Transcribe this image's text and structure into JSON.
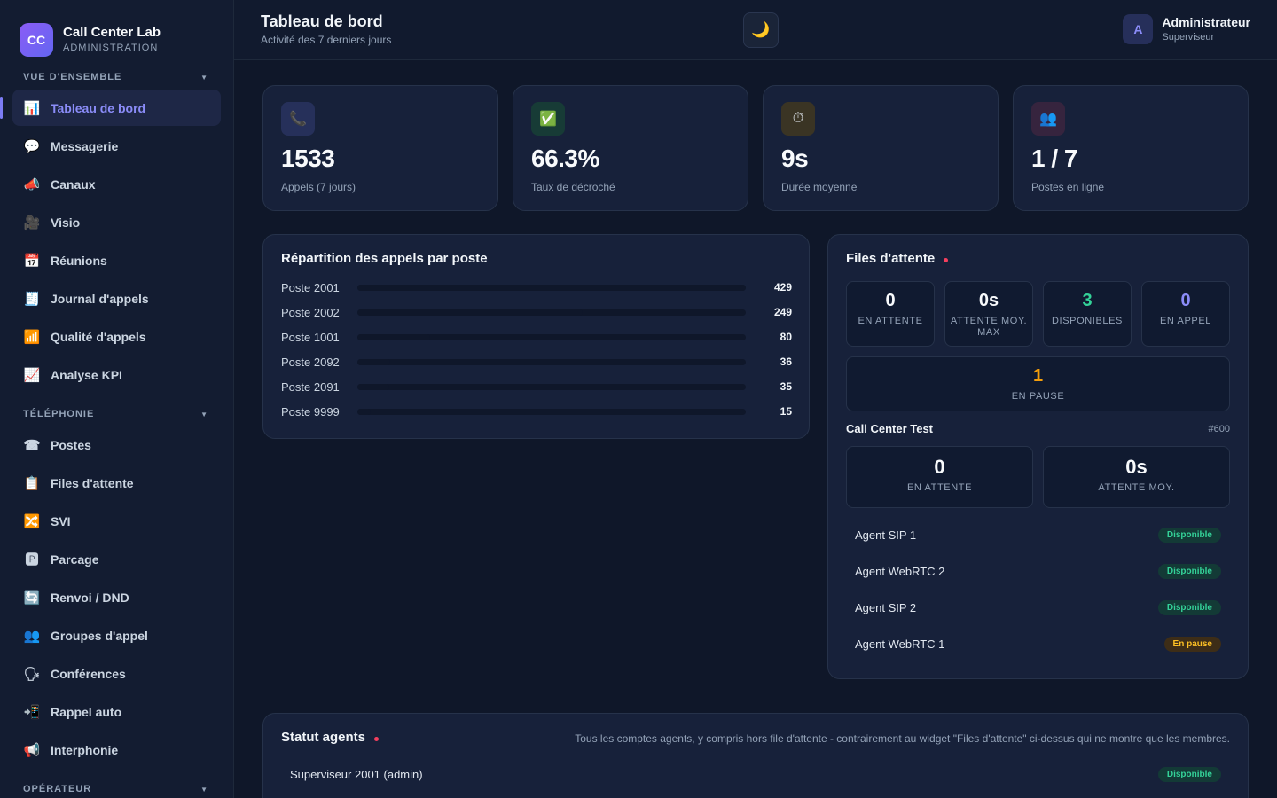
{
  "brand": {
    "logo": "CC",
    "name": "Call Center Lab",
    "subtitle": "ADMINISTRATION"
  },
  "sidebar": {
    "sections": [
      {
        "label": "VUE D'ENSEMBLE",
        "items": [
          {
            "icon": "📊",
            "icon_name": "bar-chart-icon",
            "label": "Tableau de bord",
            "active": true
          },
          {
            "icon": "💬",
            "icon_name": "speech-bubble-icon",
            "label": "Messagerie"
          },
          {
            "icon": "📣",
            "icon_name": "megaphone-icon",
            "label": "Canaux"
          },
          {
            "icon": "🎥",
            "icon_name": "video-camera-icon",
            "label": "Visio"
          },
          {
            "icon": "📅",
            "icon_name": "calendar-icon",
            "label": "Réunions"
          },
          {
            "icon": "🧾",
            "icon_name": "receipt-icon",
            "label": "Journal d'appels"
          },
          {
            "icon": "📶",
            "icon_name": "signal-icon",
            "label": "Qualité d'appels"
          },
          {
            "icon": "📈",
            "icon_name": "trend-chart-icon",
            "label": "Analyse KPI"
          }
        ]
      },
      {
        "label": "TÉLÉPHONIE",
        "items": [
          {
            "icon": "☎",
            "icon_name": "telephone-icon",
            "label": "Postes"
          },
          {
            "icon": "📋",
            "icon_name": "clipboard-icon",
            "label": "Files d'attente"
          },
          {
            "icon": "🔀",
            "icon_name": "shuffle-icon",
            "label": "SVI"
          },
          {
            "icon": "🅿",
            "icon_name": "parking-icon",
            "label": "Parcage"
          },
          {
            "icon": "🔄",
            "icon_name": "forward-icon",
            "label": "Renvoi / DND"
          },
          {
            "icon": "👥",
            "icon_name": "group-icon",
            "label": "Groupes d'appel"
          },
          {
            "icon": "🗣",
            "icon_name": "speaking-head-icon",
            "label": "Conférences"
          },
          {
            "icon": "📲",
            "icon_name": "mobile-callback-icon",
            "label": "Rappel auto"
          },
          {
            "icon": "📢",
            "icon_name": "loudspeaker-icon",
            "label": "Interphonie"
          }
        ]
      },
      {
        "label": "OPÉRATEUR",
        "items": []
      }
    ]
  },
  "header": {
    "title": "Tableau de bord",
    "subtitle": "Activité des 7 derniers jours",
    "theme_icon": "🌙"
  },
  "user": {
    "initial": "A",
    "name": "Administrateur",
    "role": "Superviseur"
  },
  "stats": [
    {
      "icon": "📞",
      "icon_name": "phone-icon",
      "icon_bg": "#26305a",
      "value": "1533",
      "label": "Appels (7 jours)"
    },
    {
      "icon": "✅",
      "icon_name": "check-icon",
      "icon_bg": "#173b36",
      "value": "66.3%",
      "label": "Taux de décroché"
    },
    {
      "icon": "⏱",
      "icon_name": "stopwatch-icon",
      "icon_bg": "#3a3424",
      "value": "9s",
      "label": "Durée moyenne"
    },
    {
      "icon": "👥",
      "icon_name": "users-icon",
      "icon_bg": "#36243e",
      "value": "1 / 7",
      "label": "Postes en ligne"
    }
  ],
  "distribution": {
    "title": "Répartition des appels par poste",
    "rows": [
      {
        "name": "Poste 2001",
        "value": 429
      },
      {
        "name": "Poste 2002",
        "value": 249
      },
      {
        "name": "Poste 1001",
        "value": 80
      },
      {
        "name": "Poste 2092",
        "value": 36
      },
      {
        "name": "Poste 2091",
        "value": 35
      },
      {
        "name": "Poste 9999",
        "value": 15
      }
    ]
  },
  "queues": {
    "title": "Files d'attente",
    "metrics": [
      {
        "value": "0",
        "label": "EN ATTENTE",
        "color": "#f8fafc"
      },
      {
        "value": "0s",
        "label": "ATTENTE MOY. MAX",
        "color": "#f8fafc"
      },
      {
        "value": "3",
        "label": "DISPONIBLES",
        "color": "#34d399"
      },
      {
        "value": "0",
        "label": "EN APPEL",
        "color": "#8b8cf8"
      }
    ],
    "paused": {
      "value": "1",
      "label": "EN PAUSE",
      "color": "#f59e0b"
    },
    "queue": {
      "name": "Call Center Test",
      "id": "#600",
      "metrics": [
        {
          "value": "0",
          "label": "EN ATTENTE"
        },
        {
          "value": "0s",
          "label": "ATTENTE MOY."
        }
      ],
      "agents": [
        {
          "name": "Agent SIP 1",
          "status": "Disponible",
          "kind": "ok"
        },
        {
          "name": "Agent WebRTC 2",
          "status": "Disponible",
          "kind": "ok"
        },
        {
          "name": "Agent SIP 2",
          "status": "Disponible",
          "kind": "ok"
        },
        {
          "name": "Agent WebRTC 1",
          "status": "En pause",
          "kind": "pause"
        }
      ]
    }
  },
  "agent_status": {
    "title": "Statut agents",
    "note": "Tous les comptes agents, y compris hors file d'attente - contrairement au widget \"Files d'attente\" ci-dessus qui ne montre que les membres.",
    "rows": [
      {
        "name": "Superviseur 2001 (admin)",
        "status": "Disponible",
        "kind": "ok"
      }
    ]
  }
}
